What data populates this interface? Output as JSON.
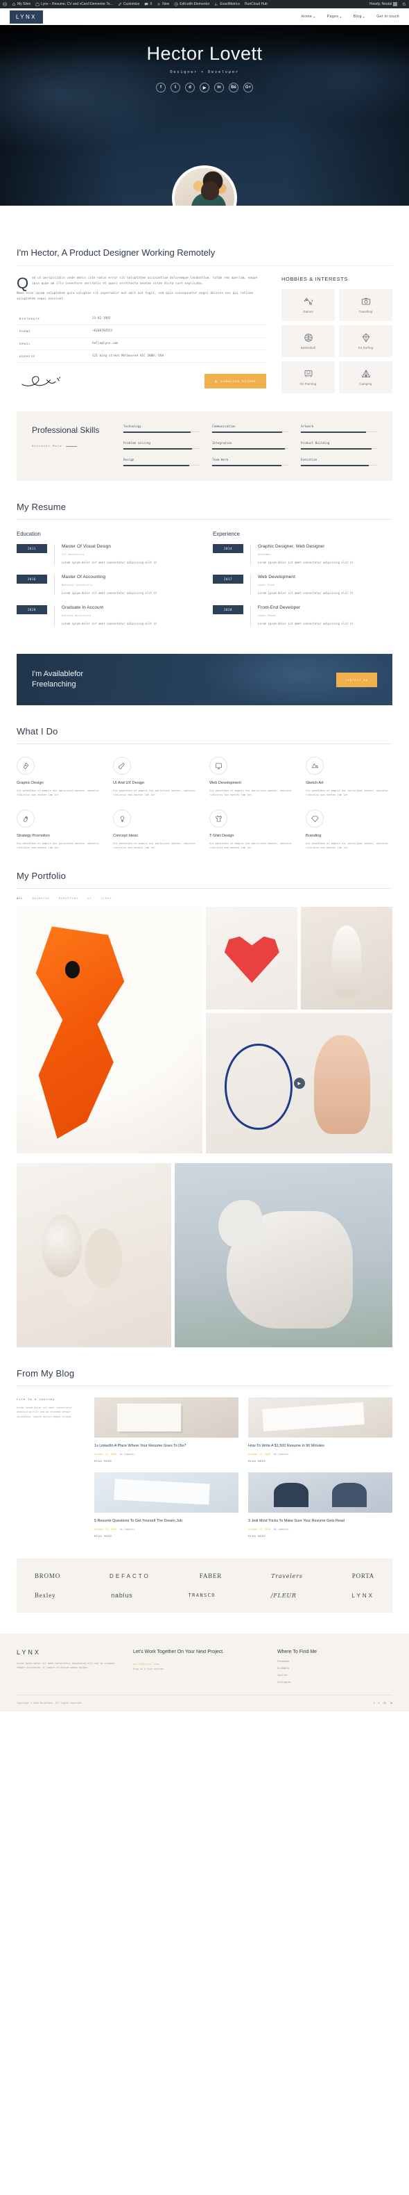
{
  "adminbar": {
    "items": [
      {
        "icon": "wordpress-icon",
        "label": ""
      },
      {
        "icon": "sites-icon",
        "label": "My Sites"
      },
      {
        "icon": "home-icon",
        "label": "Lynx – Resume, CV and vCard Elementor Te..."
      },
      {
        "icon": "pencil-icon",
        "label": "Customize"
      },
      {
        "icon": "comment-icon",
        "label": "0"
      },
      {
        "icon": "plus-icon",
        "label": "New"
      },
      {
        "icon": "elementor-icon",
        "label": "Edit with Elementor"
      },
      {
        "icon": "chart-icon",
        "label": "ExactMetrics"
      },
      {
        "icon": "cloud-icon",
        "label": "RunCloud Hub"
      }
    ],
    "howdy": "Howdy, Neutal",
    "search_icon": "search-icon"
  },
  "nav": {
    "logo": "LYNX",
    "items": [
      {
        "label": "Home",
        "caret": true
      },
      {
        "label": "Pages",
        "caret": true
      },
      {
        "label": "Blog",
        "caret": true
      },
      {
        "label": "Get in touch",
        "caret": false
      }
    ]
  },
  "hero": {
    "title": "Hector Lovett",
    "subtitle": "Designer + Developer",
    "socials": [
      {
        "name": "facebook-icon",
        "glyph": "f"
      },
      {
        "name": "twitter-icon",
        "glyph": "t"
      },
      {
        "name": "dribbble-icon",
        "glyph": "d"
      },
      {
        "name": "youtube-icon",
        "glyph": "▶"
      },
      {
        "name": "linkedin-icon",
        "glyph": "in"
      },
      {
        "name": "behance-icon",
        "glyph": "Bē"
      },
      {
        "name": "google-plus-icon",
        "glyph": "G+"
      }
    ]
  },
  "about": {
    "heading": "I'm Hector, A Product Designer Working Remotely",
    "dropcap": "Q",
    "paragraph1": "ed ut perspiciatis unde omnis iste natus error sit voluptatem accusantium doloremque laudantium, totam rem aperiam, eaque ipsa quae ab illo inventore veritatis et quasi architecto beatae vitae dicta sunt explicabo.",
    "paragraph2": "Nemo enim ipsam voluptatem quia voluptas sit aspernatur aut odit aut fugit, sed quia consequuntur magni dolores eos qui ratione voluptatem sequi nesciunt.",
    "info": [
      {
        "label": "Birthdate",
        "value": "21-02-1992"
      },
      {
        "label": "Phone",
        "value": "+6188704553"
      },
      {
        "label": "Email",
        "value": "hello@lynx.com"
      },
      {
        "label": "Address",
        "value": "121 king street Melbourne VIC 3000, USA"
      }
    ],
    "signature_alt": "signature",
    "download_button": "Download Resume",
    "download_icon": "download-icon",
    "hobbies_title": "HOBBIES & INTERESTS",
    "hobbies": [
      {
        "label": "Games",
        "icon": "dumbbell-icon"
      },
      {
        "label": "Travelling",
        "icon": "camera-icon"
      },
      {
        "label": "Basketball",
        "icon": "basketball-icon"
      },
      {
        "label": "Kit Surfing",
        "icon": "kite-icon"
      },
      {
        "label": "Oil Painting",
        "icon": "palette-icon"
      },
      {
        "label": "Camping",
        "icon": "tent-icon"
      }
    ]
  },
  "skills": {
    "title": "Professional Skills",
    "discover": "Discover More",
    "items": [
      {
        "name": "Technology",
        "level": 88
      },
      {
        "name": "Communication",
        "level": 92
      },
      {
        "name": "Artwork",
        "level": 85
      },
      {
        "name": "Problem solving",
        "level": 90
      },
      {
        "name": "Integration",
        "level": 95
      },
      {
        "name": "Product Building",
        "level": 93
      },
      {
        "name": "Design",
        "level": 86
      },
      {
        "name": "Team Work",
        "level": 91
      },
      {
        "name": "Execution",
        "level": 89
      }
    ]
  },
  "resume": {
    "title": "My Resume",
    "education_title": "Education",
    "experience_title": "Experience",
    "education": [
      {
        "year": "2011",
        "role": "Master Of Visual Design",
        "org": "ICT University",
        "desc": "Lorem ipsum dolor sit amet consectetur adipiscing elit it"
      },
      {
        "year": "2016",
        "role": "Master Of Accounting",
        "org": "National University",
        "desc": "Lorem ipsum dolor sit amet consectetur adipiscing elit it"
      },
      {
        "year": "2020",
        "role": "Graduate In Account",
        "org": "Harvard University",
        "desc": "Lorem ipsum dolor sit amet consectetur adipiscing elit it"
      }
    ],
    "experience": [
      {
        "year": "2014",
        "role": "Graphic Designer, Web Designer",
        "org": "Dethemes",
        "desc": "Lorem ipsum dolor sit amet consectetur adipiscing elit it"
      },
      {
        "year": "2017",
        "role": "Web Development",
        "org": "Coder Firm",
        "desc": "Lorem ipsum dolor sit amet consectetur adipiscing elit it"
      },
      {
        "year": "2020",
        "role": "Front-End Developer",
        "org": "Coder Panda",
        "desc": "Lorem ipsum dolor sit amet consectetur adipiscing elit it"
      }
    ]
  },
  "cta": {
    "line1": "I'm Availablefor",
    "line2": "Freelanching",
    "button": "Contact Me",
    "title": "I'm Availablefor Freelanching"
  },
  "services": {
    "title": "What I Do",
    "items": [
      {
        "name": "Graphic Design",
        "icon": "pen-nib-icon",
        "desc": "Sis penatibus et magnis dis parturient montes, nascetur ridiculus mus montes lam lot"
      },
      {
        "name": "UI And UX Design",
        "icon": "brush-icon",
        "desc": "Sis penatibus et magnis dis parturient montes, nascetur ridiculus mus montes lam lot"
      },
      {
        "name": "Web Development",
        "icon": "monitor-icon",
        "desc": "Sis penatibus et magnis dis parturient montes, nascetur ridiculus mus montes lam lot"
      },
      {
        "name": "Sketch Art",
        "icon": "sketch-icon",
        "desc": "Sis penatibus et magnis dis parturient montes, nascetur ridiculus mus montes lam lot"
      },
      {
        "name": "Strategy Promotion",
        "icon": "rocket-icon",
        "desc": "Sis penatibus et magnis dis parturient montes, nascetur ridiculus mus montes lam lot"
      },
      {
        "name": "Concept Ideas",
        "icon": "bulb-icon",
        "desc": "Sis penatibus et magnis dis parturient montes, nascetur ridiculus mus montes lam lot"
      },
      {
        "name": "T-Shirt Design",
        "icon": "tshirt-icon",
        "desc": "Sis penatibus et magnis dis parturient montes, nascetur ridiculus mus montes lam lot"
      },
      {
        "name": "Branding",
        "icon": "diamond-icon",
        "desc": "Sis penatibus et magnis dis parturient montes, nascetur ridiculus mus montes lam lot"
      }
    ]
  },
  "portfolio": {
    "title": "My Portfolio",
    "filters": [
      "ALL",
      "BRANDING",
      "MARKETING",
      "UI",
      "VIDEO"
    ],
    "active_filter": "ALL",
    "play_icon": "play-icon"
  },
  "blog": {
    "title": "From My Blog",
    "side_heading": "Life Is A Journey",
    "side_text": "Lorem ipsum dolor sit amet consectetur adipiscing elit sed do eiusmod tempor incididunt labore dolore magna aliqua.",
    "posts": [
      {
        "title": "1s LinkedIn A Place Where Your Resume Goes To Die?",
        "date": "October 13, 2020",
        "meta": "No Comments",
        "read": "Read More"
      },
      {
        "title": "How To Write A $1,500 Resume In 90 Minutes",
        "date": "October 13, 2020",
        "meta": "No Comments",
        "read": "Read More"
      },
      {
        "title": "5 Resume Questions To Get Yourself The Dream Job",
        "date": "October 13, 2020",
        "meta": "No Comments",
        "read": "Read More"
      },
      {
        "title": "3 Jedi Mind Tricks To Make Sure Your Resume Gets Read",
        "date": "October 13, 2020",
        "meta": "No Comments",
        "read": "Read More"
      }
    ]
  },
  "brands": {
    "row1": [
      "BROMO",
      "DEFACTO",
      "FABER",
      "Travelers",
      "PORTA"
    ],
    "row2": [
      "Bexley",
      "nablus",
      "TRANSCO",
      "/FLEUR",
      "LYNX"
    ]
  },
  "footer": {
    "logo": "LYNX",
    "description": "Lorem ipsum dolor sit amet consectetur adipiscing elit sed do eiusmod tempor incididunt ut labore et dolore magna aliqua.",
    "work_title": "Let's Work Together On Your Next Project.",
    "email": "hello@lynx.com",
    "email_sub": "Drop us a line anytime",
    "find_title": "Where To Find Me",
    "links": [
      "Facebook",
      "Dribbble",
      "Twitter",
      "Instagram"
    ],
    "copyright": "Copyright © 2020 Nicktheme. All rights reserved.",
    "socials": [
      {
        "name": "facebook-icon",
        "glyph": "f"
      },
      {
        "name": "twitter-icon",
        "glyph": "t"
      },
      {
        "name": "instagram-icon",
        "glyph": "◎"
      },
      {
        "name": "linkedin-icon",
        "glyph": "in"
      }
    ]
  },
  "colors": {
    "navy": "#2c4059",
    "accent": "#f0b04b",
    "cream": "#f6f2ee"
  }
}
